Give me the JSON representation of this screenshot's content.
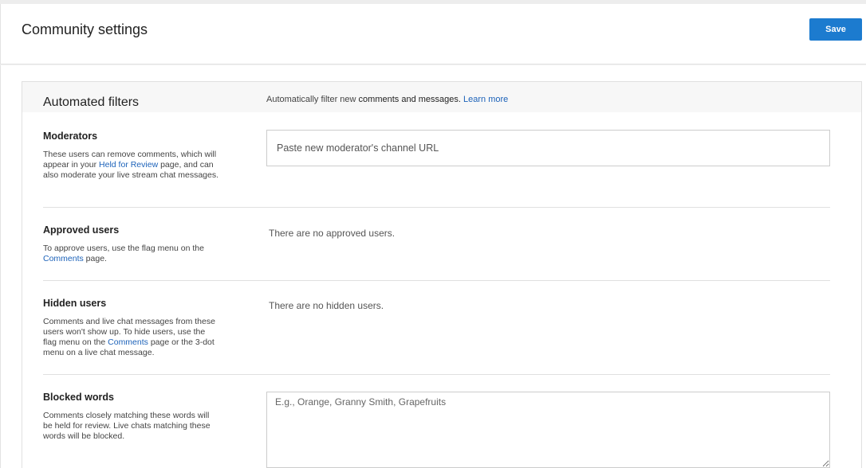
{
  "header": {
    "title": "Community settings",
    "save_label": "Save"
  },
  "card": {
    "title": "Automated filters",
    "desc_prefix": "Automatically filter new ",
    "desc_bold": "comments and messages.",
    "desc_link": "Learn more"
  },
  "moderators": {
    "title": "Moderators",
    "desc_1": "These users can remove comments, which will appear in your ",
    "desc_link": "Held for Review",
    "desc_2": " page, and can also moderate your live stream chat messages.",
    "placeholder": "Paste new moderator's channel URL"
  },
  "approved": {
    "title": "Approved users",
    "desc_1": "To approve users, use the flag menu on the ",
    "desc_link": "Comments",
    "desc_2": " page.",
    "empty": "There are no approved users."
  },
  "hidden": {
    "title": "Hidden users",
    "desc_1": "Comments and live chat messages from these users won't show up. To hide users, use the flag menu on the ",
    "desc_link": "Comments",
    "desc_2": " page or the 3-dot menu on a live chat message.",
    "empty": "There are no hidden users."
  },
  "blocked": {
    "title": "Blocked words",
    "desc": "Comments closely matching these words will be held for review. Live chats matching these words will be blocked.",
    "placeholder": "E.g., Orange, Granny Smith, Grapefruits"
  }
}
